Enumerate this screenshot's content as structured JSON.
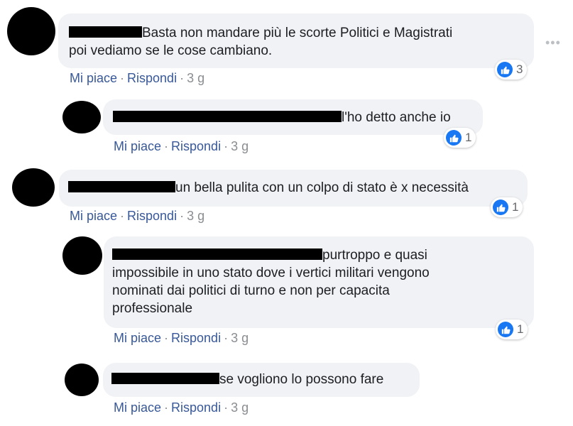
{
  "colors": {
    "link": "#385898",
    "bubble": "#f0f2f5",
    "like": "#1877f2"
  },
  "icons": {
    "like": "thumbs-up-icon",
    "more": "more-horizontal-icon"
  },
  "actions": {
    "like_label": "Mi piace",
    "reply_label": "Rispondi",
    "separator": "·"
  },
  "comments": [
    {
      "text_line1": "Basta non mandare più le scorte Politici e Magistrati",
      "text_line2": "poi vediamo se le cose cambiano.",
      "time": "3 g",
      "reactions": "3"
    },
    {
      "text": "l'ho detto anche io",
      "time": "3 g",
      "reactions": "1"
    },
    {
      "text": "un bella pulita con un colpo di stato è x necessità",
      "time": "3 g",
      "reactions": "1"
    },
    {
      "text_line1": "purtroppo e quasi",
      "text_line2": "impossibile in uno stato dove i vertici militari vengono",
      "text_line3": "nominati dai politici di turno e non per capacita",
      "text_line4": "professionale",
      "time": "3 g",
      "reactions": "1"
    },
    {
      "text": "se vogliono lo possono fare",
      "time": "3 g"
    }
  ]
}
